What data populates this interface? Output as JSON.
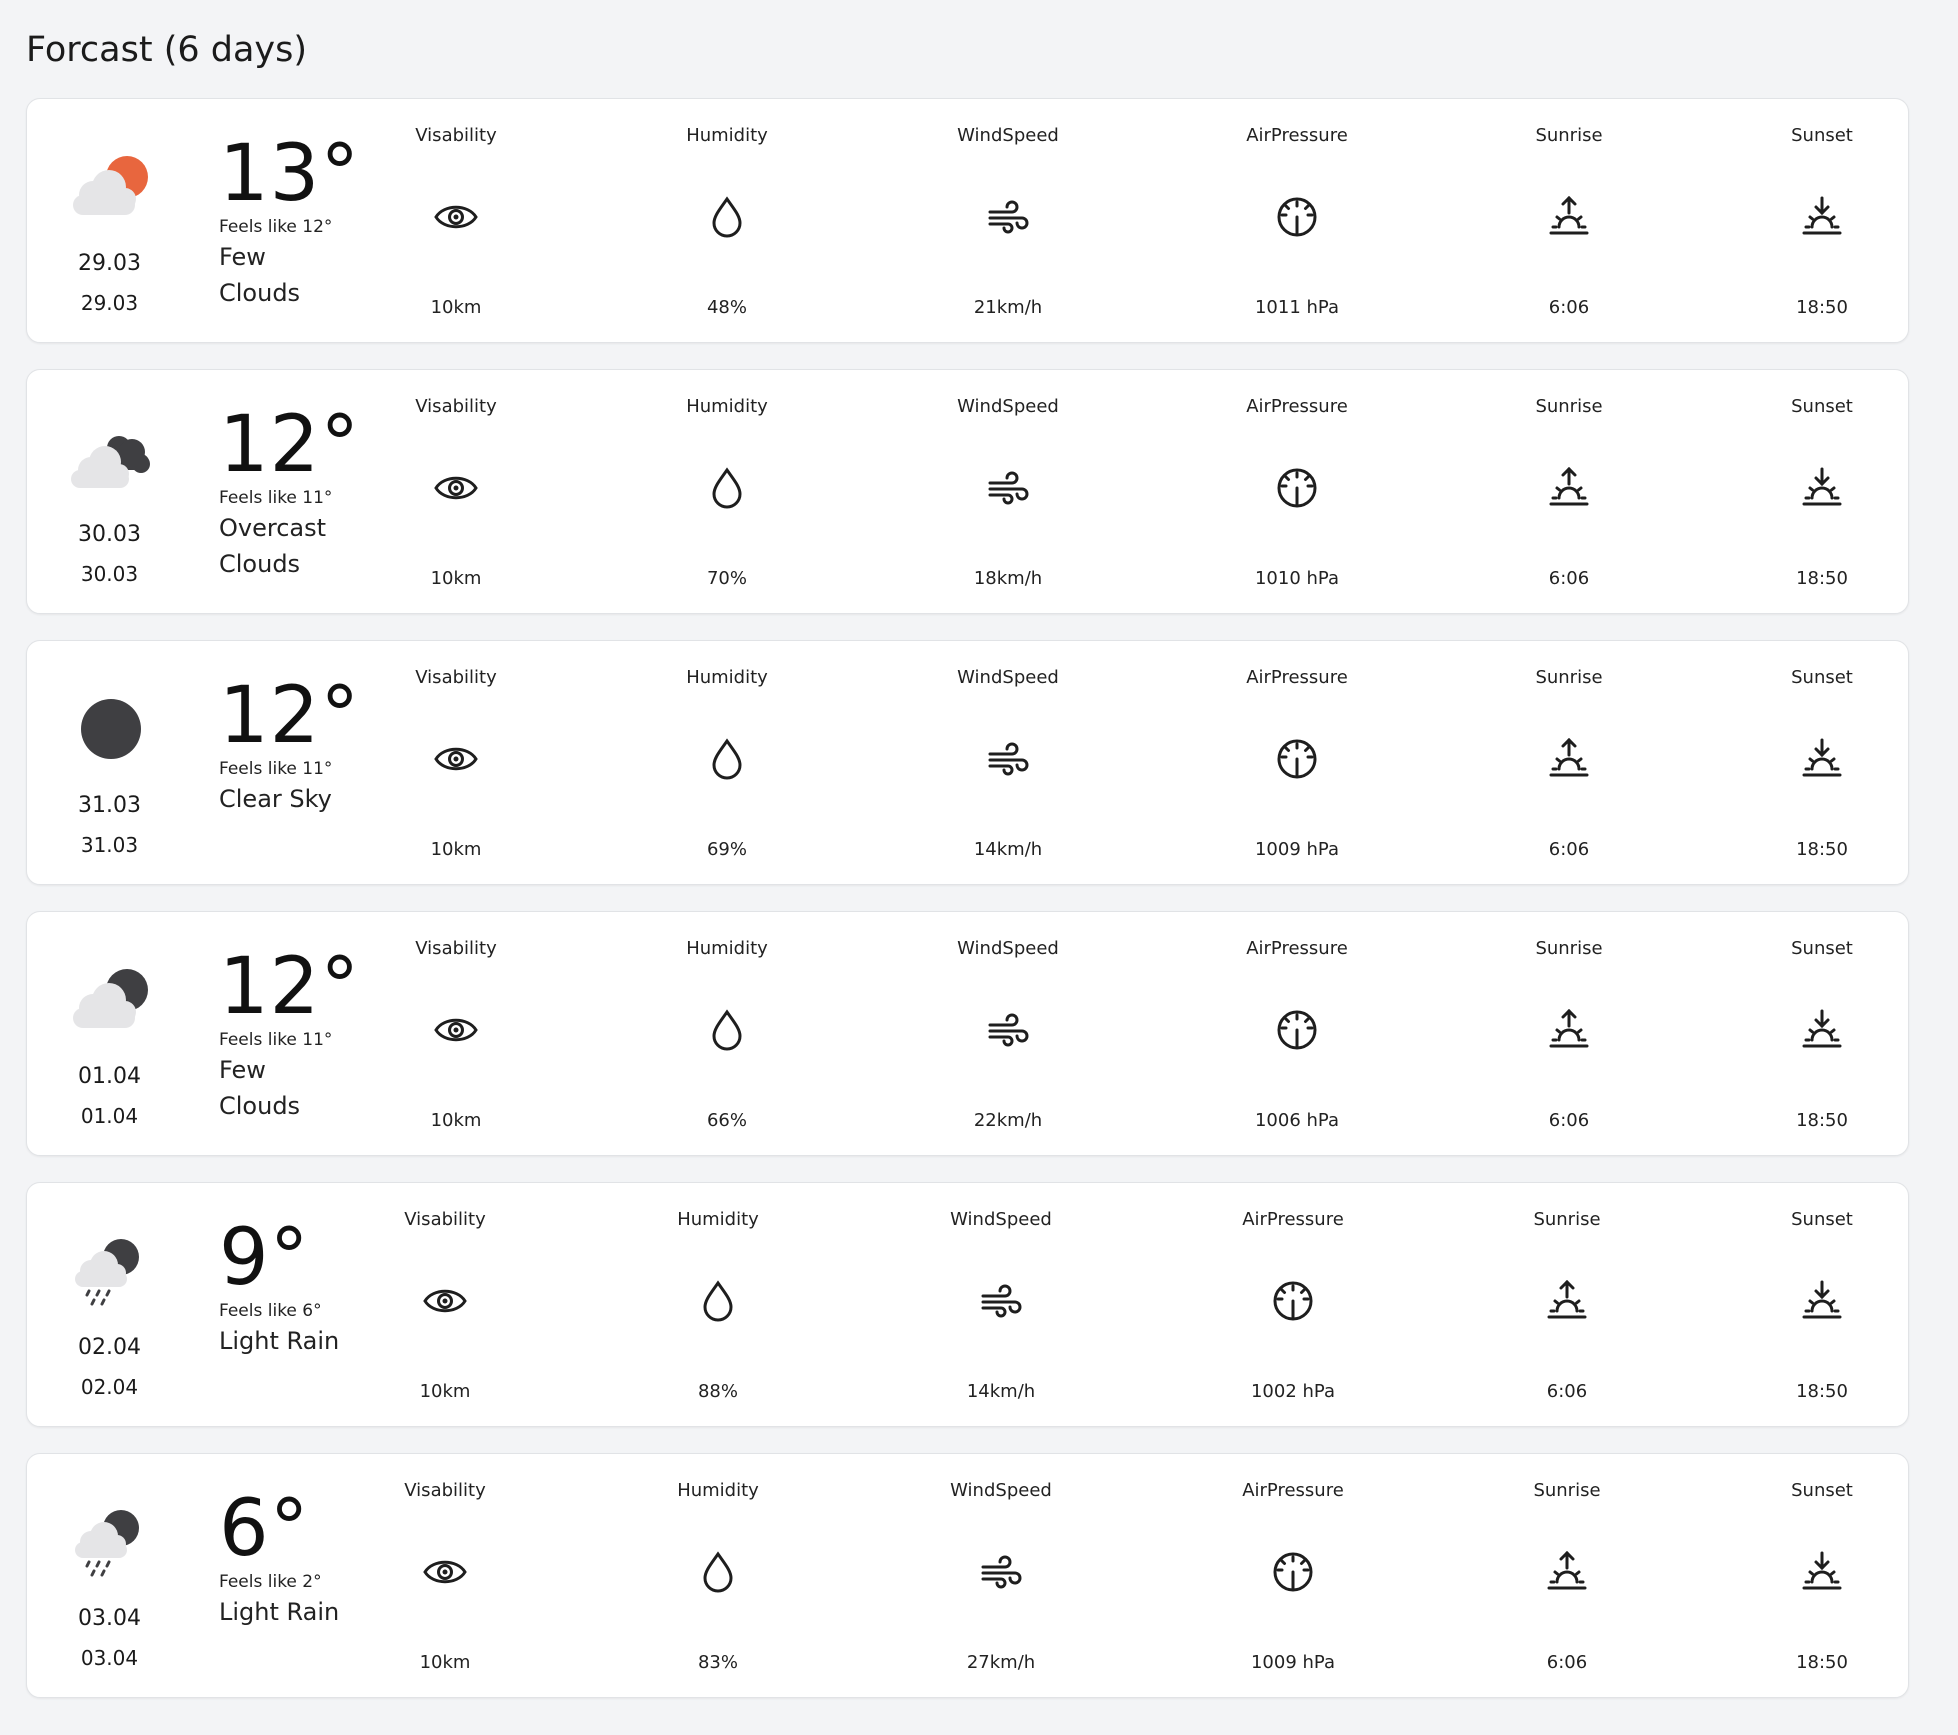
{
  "page": {
    "title": "Forcast (6 days)"
  },
  "colors": {
    "background": "#f3f4f6",
    "card": "#ffffff",
    "sun": "#e8663e",
    "dark_cloud": "#3f3f42",
    "light_cloud": "#e5e5e7"
  },
  "labels": {
    "visibility": "Visability",
    "humidity": "Humidity",
    "wind": "WindSpeed",
    "pressure": "AirPressure",
    "sunrise": "Sunrise",
    "sunset": "Sunset"
  },
  "days": [
    {
      "date1": "29.03",
      "date2": "29.03",
      "icon": "few-clouds-day-icon",
      "temp": "13°",
      "feels": "Feels like 12°",
      "desc": "Few Clouds",
      "visibility": "10km",
      "humidity": "48%",
      "wind": "21km/h",
      "pressure": "1011 hPa",
      "sunrise": "6:06",
      "sunset": "18:50"
    },
    {
      "date1": "30.03",
      "date2": "30.03",
      "icon": "overcast-clouds-icon",
      "temp": "12°",
      "feels": "Feels like 11°",
      "desc": "Overcast Clouds",
      "visibility": "10km",
      "humidity": "70%",
      "wind": "18km/h",
      "pressure": "1010 hPa",
      "sunrise": "6:06",
      "sunset": "18:50"
    },
    {
      "date1": "31.03",
      "date2": "31.03",
      "icon": "clear-sky-night-icon",
      "temp": "12°",
      "feels": "Feels like 11°",
      "desc": "Clear Sky",
      "visibility": "10km",
      "humidity": "69%",
      "wind": "14km/h",
      "pressure": "1009 hPa",
      "sunrise": "6:06",
      "sunset": "18:50"
    },
    {
      "date1": "01.04",
      "date2": "01.04",
      "icon": "few-clouds-night-icon",
      "temp": "12°",
      "feels": "Feels like 11°",
      "desc": "Few Clouds",
      "visibility": "10km",
      "humidity": "66%",
      "wind": "22km/h",
      "pressure": "1006 hPa",
      "sunrise": "6:06",
      "sunset": "18:50"
    },
    {
      "date1": "02.04",
      "date2": "02.04",
      "icon": "light-rain-night-icon",
      "temp": "9°",
      "feels": "Feels like 6°",
      "desc": "Light Rain",
      "visibility": "10km",
      "humidity": "88%",
      "wind": "14km/h",
      "pressure": "1002 hPa",
      "sunrise": "6:06",
      "sunset": "18:50"
    },
    {
      "date1": "03.04",
      "date2": "03.04",
      "icon": "light-rain-night-icon",
      "temp": "6°",
      "feels": "Feels like 2°",
      "desc": "Light Rain",
      "visibility": "10km",
      "humidity": "83%",
      "wind": "27km/h",
      "pressure": "1009 hPa",
      "sunrise": "6:06",
      "sunset": "18:50"
    }
  ]
}
